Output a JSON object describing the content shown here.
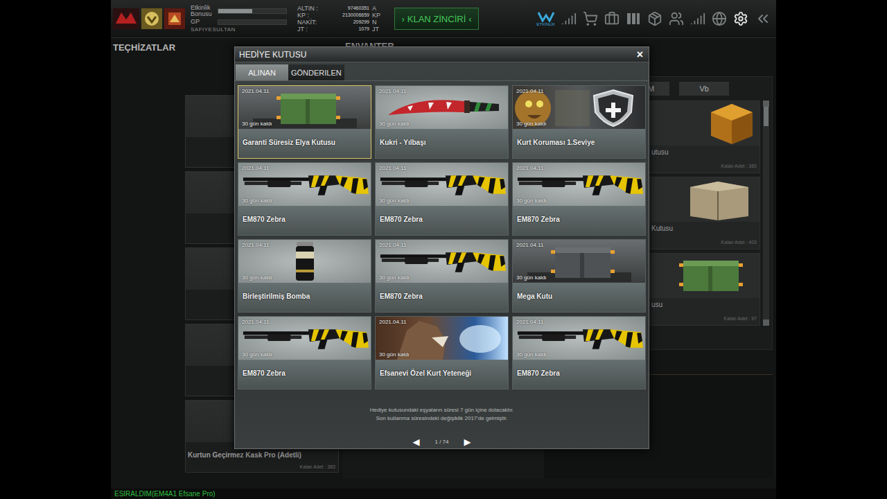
{
  "player": {
    "name": "SAFIYESULTAN",
    "bonus_label": "Etkinlik Bonusu",
    "bonus_level": 0.5,
    "gp_label": "GP",
    "gp_level": 0.0
  },
  "currencies": [
    {
      "label": "ALTIN :",
      "value": "97460351",
      "unit": "A"
    },
    {
      "label": "KP :",
      "value": "2130006659",
      "unit": "KP"
    },
    {
      "label": "NAKİT:",
      "value": "209299",
      "unit": "N"
    },
    {
      "label": "JT :",
      "value": "1079",
      "unit": "JT"
    }
  ],
  "clan_chain_button": {
    "left": "›",
    "label": "KLAN ZİNCİRİ",
    "right": "‹"
  },
  "event_label": "ETKİNLİK",
  "sections": {
    "equipment": "TEÇHİZATLAR",
    "inventory": "ENVANTER"
  },
  "inventory_tabs": [
    {
      "label": "M",
      "selected": false
    },
    {
      "label": "Vb",
      "selected": false
    }
  ],
  "inventory_items": [
    {
      "name": "utusu",
      "remaining": "Kalan Adet : 360",
      "kind": "dice"
    },
    {
      "name": "Kutusu",
      "remaining": "Kalan Adet : 403",
      "kind": "crate10"
    },
    {
      "name": "usu",
      "remaining": "Kalan Adet : 97",
      "kind": "crate"
    }
  ],
  "equipment_slot": {
    "name": "Kurtun Geçirmez Kask Pro (Adetli)",
    "remaining": "Kalan Adet : 383"
  },
  "status_line": "ESIRALDIM(EM4A1 Efsane Pro)",
  "dialog": {
    "title": "HEDİYE KUTUSU",
    "close": "×",
    "tabs": [
      {
        "label": "ALINAN",
        "selected": true
      },
      {
        "label": "GÖNDERILEN",
        "selected": false
      }
    ],
    "items": [
      {
        "date": "2021.04.11",
        "remaining": "30 gün kaldı",
        "name": "Garanti Süresiz Elya Kutusu",
        "kind": "crate",
        "selected": true
      },
      {
        "date": "2021.04.11",
        "remaining": "30 gün kaldı",
        "name": "Kukri - Yılbaşı",
        "kind": "knife",
        "selected": false
      },
      {
        "date": "2021.04.11",
        "remaining": "30 gün kaldı",
        "name": "Kurt Koruması 1.Seviye",
        "kind": "shield",
        "selected": false
      },
      {
        "date": "2021.04.11",
        "remaining": "30 gün kaldı",
        "name": "EM870 Zebra",
        "kind": "shotgun",
        "selected": false
      },
      {
        "date": "2021.04.11",
        "remaining": "30 gün kaldı",
        "name": "EM870 Zebra",
        "kind": "shotgun",
        "selected": false
      },
      {
        "date": "2021.04.11",
        "remaining": "30 gün kaldı",
        "name": "EM870 Zebra",
        "kind": "shotgun",
        "selected": false
      },
      {
        "date": "2021.04.11",
        "remaining": "30 gün kaldı",
        "name": "Birleştirilmiş Bomba",
        "kind": "grenade",
        "selected": false
      },
      {
        "date": "2021.04.11",
        "remaining": "30 gün kaldı",
        "name": "EM870 Zebra",
        "kind": "shotgun",
        "selected": false
      },
      {
        "date": "2021.04.11",
        "remaining": "30 gün kaldı",
        "name": "Mega Kutu",
        "kind": "megabox",
        "selected": false
      },
      {
        "date": "2021.04.11",
        "remaining": "30 gün kaldı",
        "name": "EM870 Zebra",
        "kind": "shotgun",
        "selected": false
      },
      {
        "date": "2021.04.11",
        "remaining": "30 gün kaldı",
        "name": "Efsanevi Özel Kurt Yeteneği",
        "kind": "wolf",
        "selected": false
      },
      {
        "date": "2021.04.11",
        "remaining": "30 gün kaldı",
        "name": "EM870 Zebra",
        "kind": "shotgun",
        "selected": false
      }
    ],
    "footer": [
      "Hediye kutusundaki eşyaların süresi 7 gün içine dolacaktır.",
      "Son kullanma süresindeki değişiklik 2017'de gelmiştir."
    ],
    "pager": {
      "prev": "◀",
      "page": "1 / 74",
      "next": "▶"
    }
  }
}
